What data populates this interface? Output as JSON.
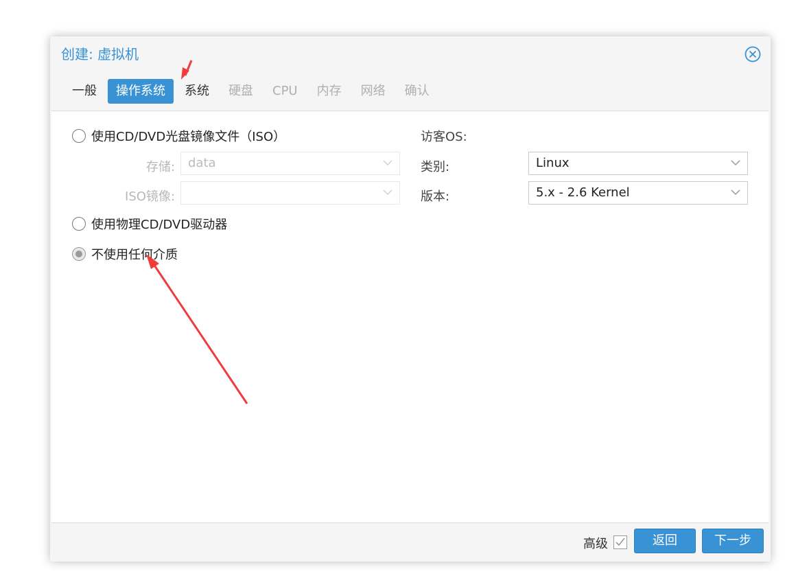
{
  "dialog": {
    "title": "创建: 虚拟机",
    "close_icon": "close-circle-icon"
  },
  "tabs": [
    {
      "label": "一般",
      "state": "normal"
    },
    {
      "label": "操作系统",
      "state": "active"
    },
    {
      "label": "系统",
      "state": "normal"
    },
    {
      "label": "硬盘",
      "state": "disabled"
    },
    {
      "label": "CPU",
      "state": "disabled"
    },
    {
      "label": "内存",
      "state": "disabled"
    },
    {
      "label": "网络",
      "state": "disabled"
    },
    {
      "label": "确认",
      "state": "disabled"
    }
  ],
  "media": {
    "option_iso": "使用CD/DVD光盘镜像文件（ISO）",
    "storage_label": "存储:",
    "storage_value": "data",
    "iso_label": "ISO镜像:",
    "iso_value": "",
    "option_physical": "使用物理CD/DVD驱动器",
    "option_none": "不使用任何介质",
    "selected": "option_none"
  },
  "guest_os": {
    "heading": "访客OS:",
    "type_label": "类别:",
    "type_value": "Linux",
    "version_label": "版本:",
    "version_value": "5.x - 2.6 Kernel"
  },
  "footer": {
    "advanced_label": "高级",
    "advanced_checked": true,
    "back_label": "返回",
    "next_label": "下一步"
  },
  "colors": {
    "accent": "#3892d4",
    "annotation_arrow": "#f03c3c"
  }
}
